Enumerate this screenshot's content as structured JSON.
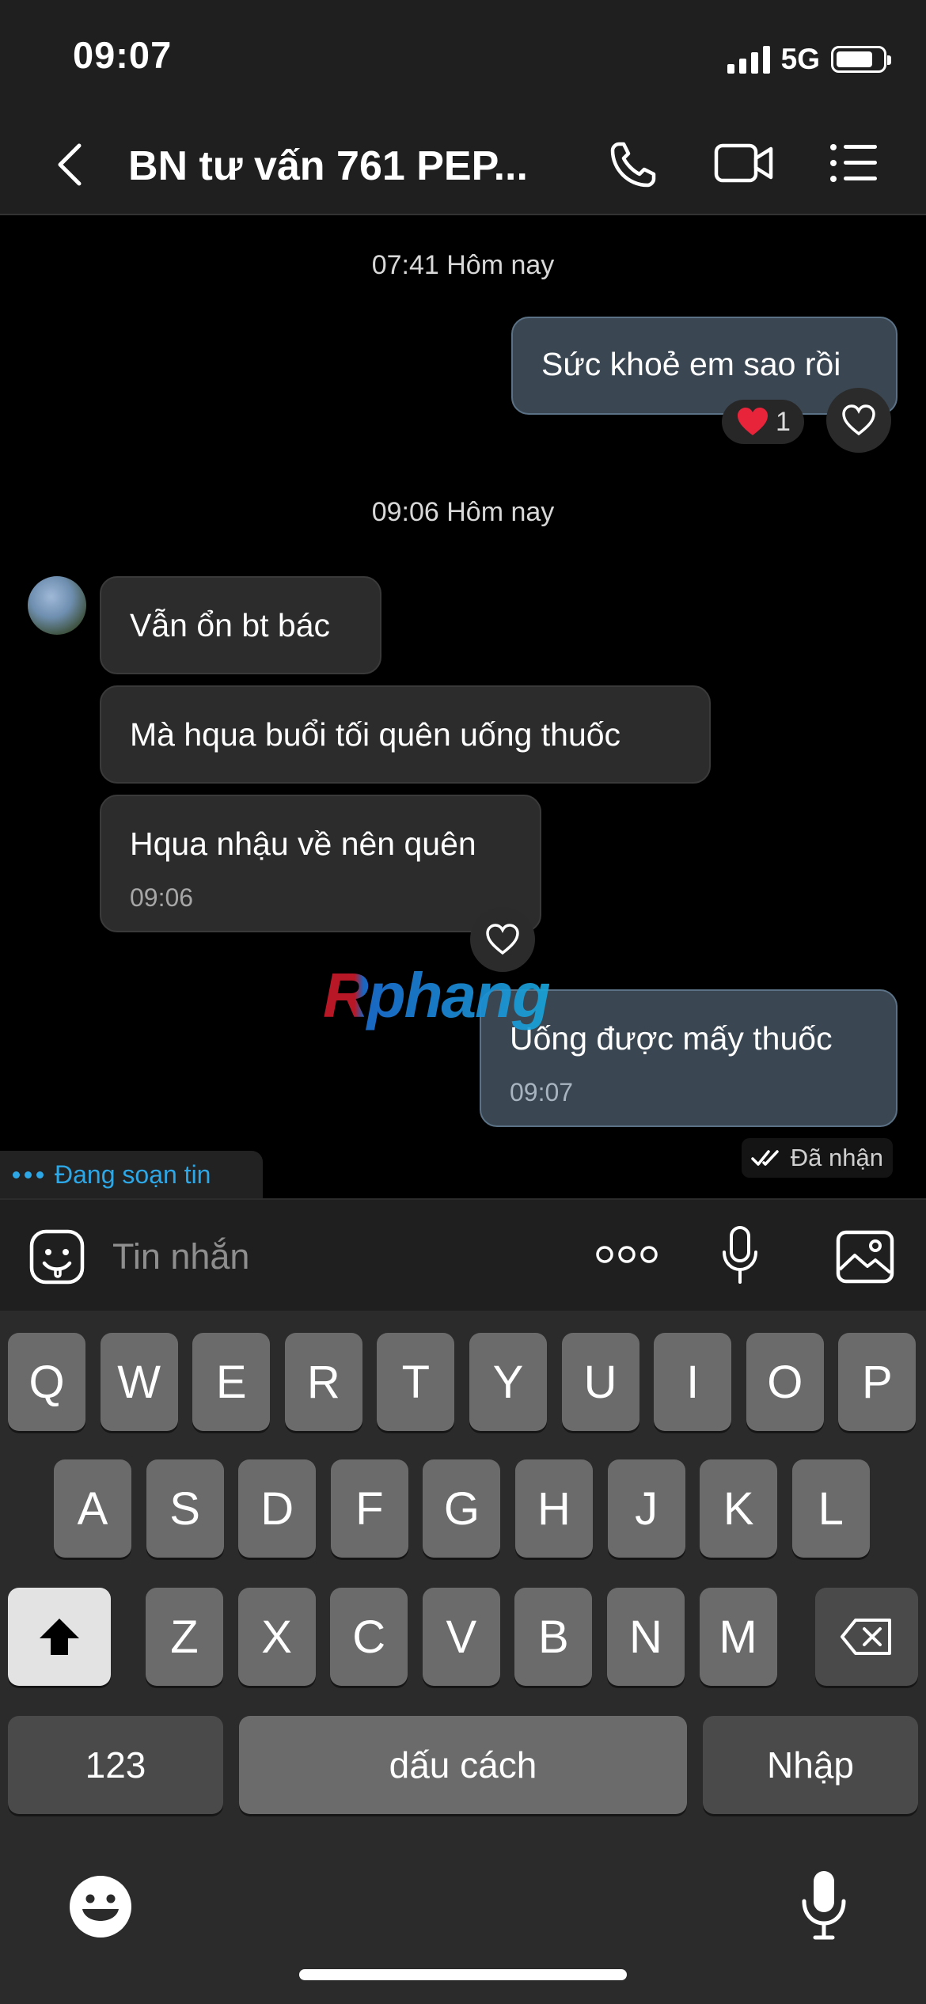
{
  "status_bar": {
    "time": "09:07",
    "network": "5G"
  },
  "header": {
    "title": "BN tư vấn 761 PEP..."
  },
  "chat": {
    "ts1": "07:41 Hôm nay",
    "out1": "Sức khoẻ em sao rồi",
    "out1_reaction_count": "1",
    "ts2": "09:06 Hôm nay",
    "in1": "Vẫn ổn bt bác",
    "in2": "Mà hqua buổi tối quên uống thuốc",
    "in3": "Hqua nhậu về nên quên",
    "in3_time": "09:06",
    "out2": "Uống được mấy thuốc",
    "out2_time": "09:07",
    "receipt": "Đã nhận",
    "typing": "Đang soạn tin",
    "watermark": "Rphang"
  },
  "composer": {
    "placeholder": "Tin nhắn"
  },
  "keyboard": {
    "row1": [
      "Q",
      "W",
      "E",
      "R",
      "T",
      "Y",
      "U",
      "I",
      "O",
      "P"
    ],
    "row2": [
      "A",
      "S",
      "D",
      "F",
      "G",
      "H",
      "J",
      "K",
      "L"
    ],
    "row3": [
      "Z",
      "X",
      "C",
      "V",
      "B",
      "N",
      "M"
    ],
    "numbers_label": "123",
    "space_label": "dấu cách",
    "enter_label": "Nhập"
  },
  "colors": {
    "accent": "#2ea7e6",
    "outgoing_bubble": "#3a4652",
    "incoming_bubble": "#2c2c2c"
  }
}
